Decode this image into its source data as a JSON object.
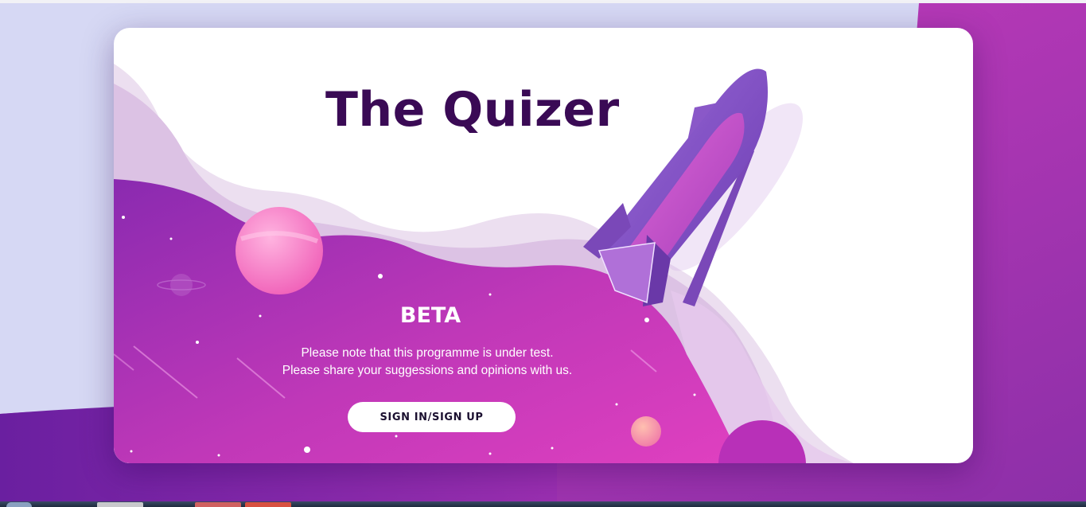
{
  "app": {
    "title": "The Quizer",
    "beta_label": "BETA",
    "notice": [
      "Please note that this programme is under test.",
      "Please share your suggessions and opinions with us."
    ],
    "signin_label": "SIGN IN/SIGN UP"
  },
  "colors": {
    "title": "#3a0a55",
    "accent_magenta": "#c636b8",
    "accent_purple": "#7a2fa8",
    "button_bg": "#ffffff"
  },
  "icons": [
    "rocket-icon",
    "planet-icon",
    "star-icon"
  ]
}
